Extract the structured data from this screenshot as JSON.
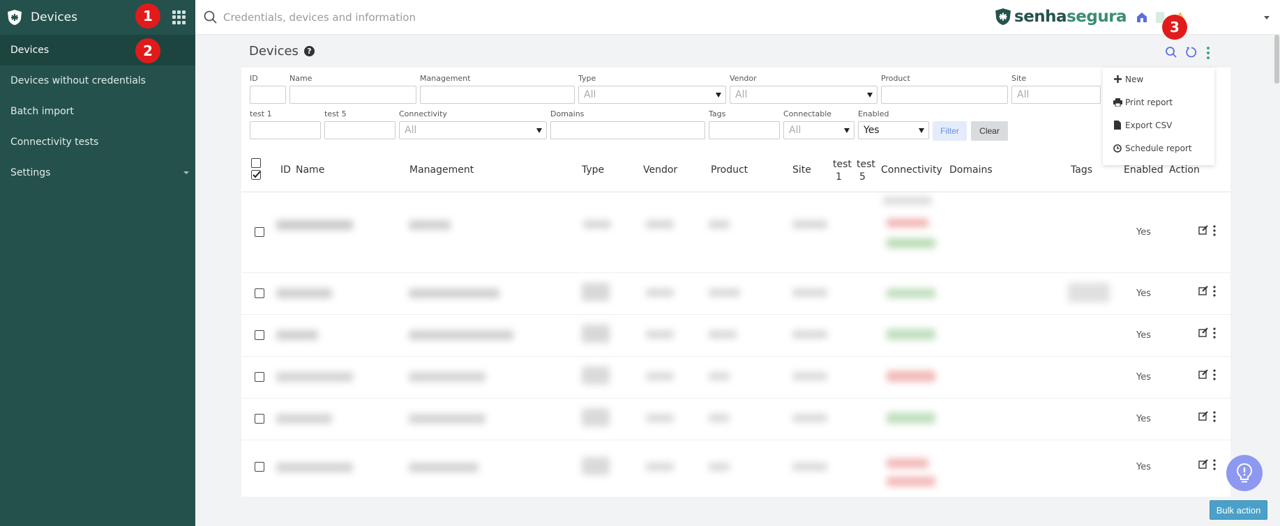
{
  "sidebar": {
    "title": "Devices",
    "items": [
      {
        "label": "Devices"
      },
      {
        "label": "Devices without credentials"
      },
      {
        "label": "Batch import"
      },
      {
        "label": "Connectivity tests"
      },
      {
        "label": "Settings"
      }
    ]
  },
  "badges": [
    "1",
    "2",
    "3"
  ],
  "topbar": {
    "search_placeholder": "Credentials, devices and information",
    "brand_part1": "senha",
    "brand_part2": "segura"
  },
  "page": {
    "title": "Devices",
    "help": "?"
  },
  "filters": {
    "id": "ID",
    "name": "Name",
    "management": "Management",
    "type": "Type",
    "type_value": "All",
    "vendor": "Vendor",
    "vendor_value": "All",
    "product": "Product",
    "site": "Site",
    "site_value": "All",
    "test1": "test 1",
    "test5": "test 5",
    "connectivity": "Connectivity",
    "connectivity_value": "All",
    "domains": "Domains",
    "tags": "Tags",
    "connectable": "Connectable",
    "connectable_value": "All",
    "enabled": "Enabled",
    "enabled_value": "Yes",
    "filter_button": "Filter",
    "clear_button": "Clear"
  },
  "table": {
    "headers": {
      "id": "ID",
      "name": "Name",
      "management": "Management",
      "type": "Type",
      "vendor": "Vendor",
      "product": "Product",
      "site": "Site",
      "test1_a": "test",
      "test1_b": "1",
      "test5_a": "test",
      "test5_b": "5",
      "connectivity": "Connectivity",
      "domains": "Domains",
      "tags": "Tags",
      "enabled": "Enabled",
      "action": "Action"
    },
    "rows": [
      {
        "enabled": "Yes"
      },
      {
        "enabled": "Yes"
      },
      {
        "enabled": "Yes"
      },
      {
        "enabled": "Yes"
      },
      {
        "enabled": "Yes"
      },
      {
        "enabled": "Yes"
      }
    ]
  },
  "menu": {
    "new": "New",
    "print_report": "Print report",
    "export_csv": "Export CSV",
    "schedule_report": "Schedule report"
  },
  "footer": {
    "bulk_action": "Bulk action"
  },
  "colors": {
    "sidebar_bg": "#24514b",
    "accent_blue": "#5b6ee0",
    "accent_green": "#3b8d75",
    "bulk_button": "#4aa0c8",
    "badge_red": "#e11b1b"
  }
}
